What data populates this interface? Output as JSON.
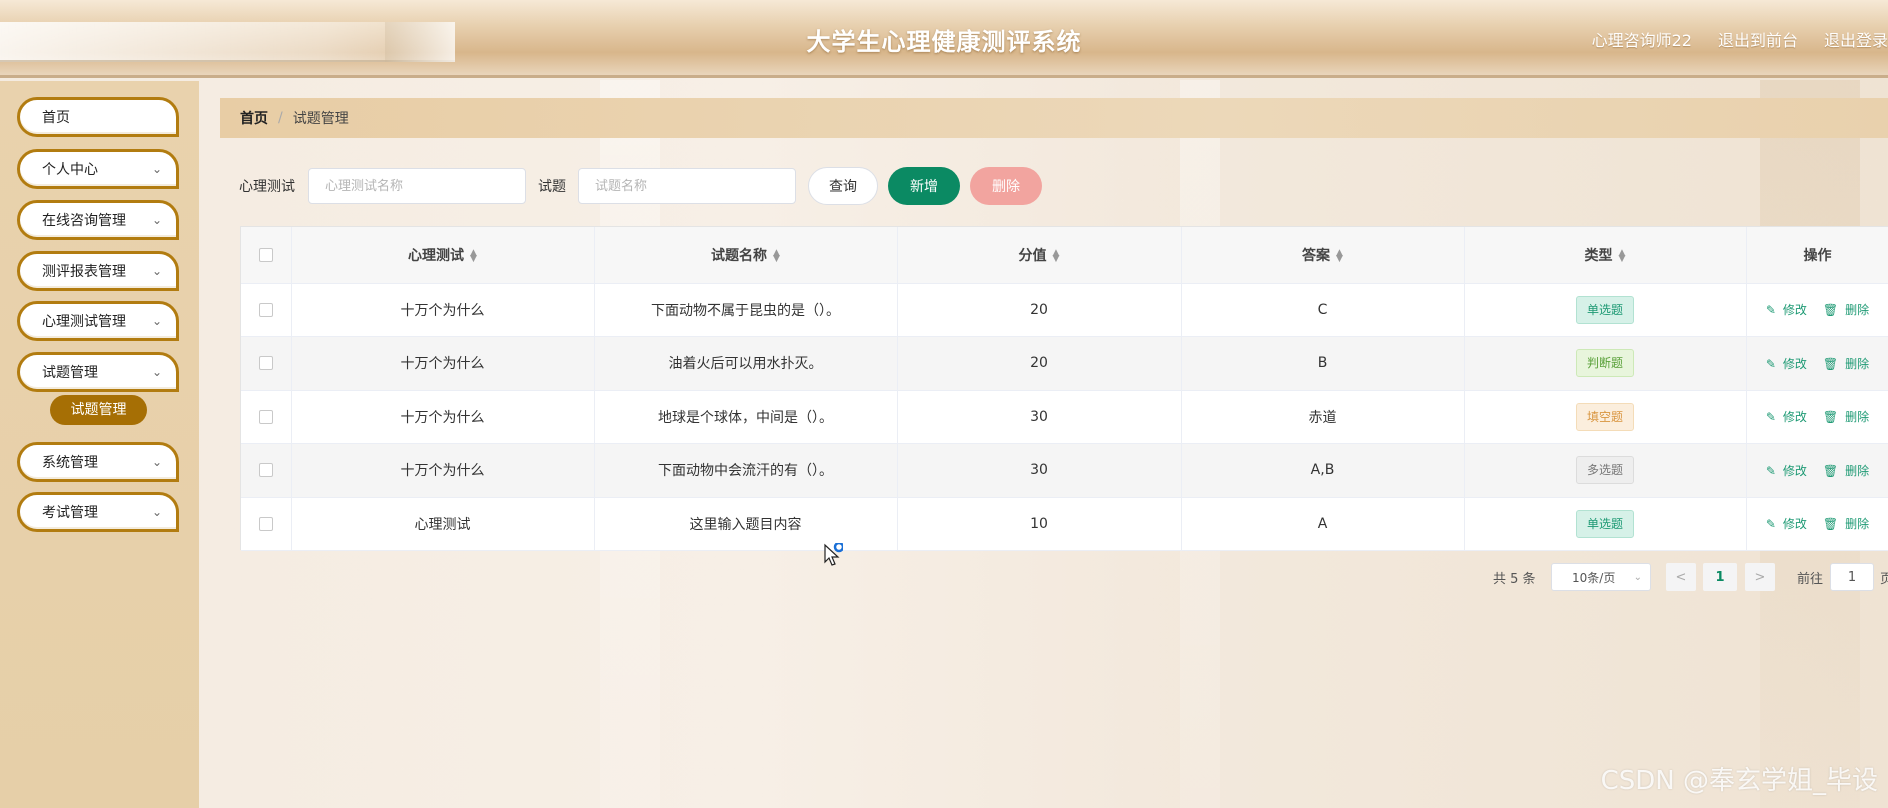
{
  "header": {
    "title": "大学生心理健康测评系统",
    "user": "心理咨询师22",
    "back_front": "退出到前台",
    "logout": "退出登录"
  },
  "sidebar": {
    "items": [
      {
        "label": "首页",
        "has_chevron": false
      },
      {
        "label": "个人中心",
        "has_chevron": true
      },
      {
        "label": "在线咨询管理",
        "has_chevron": true
      },
      {
        "label": "测评报表管理",
        "has_chevron": true
      },
      {
        "label": "心理测试管理",
        "has_chevron": true
      },
      {
        "label": "试题管理",
        "has_chevron": true
      },
      {
        "label": "系统管理",
        "has_chevron": true
      },
      {
        "label": "考试管理",
        "has_chevron": true
      }
    ],
    "sub_active": "试题管理"
  },
  "breadcrumb": {
    "home": "首页",
    "separator": "/",
    "current": "试题管理"
  },
  "search": {
    "test_label": "心理测试",
    "test_placeholder": "心理测试名称",
    "question_label": "试题",
    "question_placeholder": "试题名称",
    "query_button": "查询",
    "add_button": "新增",
    "delete_button": "删除"
  },
  "table": {
    "columns": [
      "心理测试",
      "试题名称",
      "分值",
      "答案",
      "类型",
      "操作"
    ],
    "rows": [
      {
        "test": "十万个为什么",
        "question": "下面动物不属于昆虫的是（）。",
        "score": "20",
        "answer": "C",
        "type": "单选题",
        "type_style": "single"
      },
      {
        "test": "十万个为什么",
        "question": "油着火后可以用水扑灭。",
        "score": "20",
        "answer": "B",
        "type": "判断题",
        "type_style": "judge"
      },
      {
        "test": "十万个为什么",
        "question": "地球是个球体，中间是（）。",
        "score": "30",
        "answer": "赤道",
        "type": "填空题",
        "type_style": "fill"
      },
      {
        "test": "十万个为什么",
        "question": "下面动物中会流汗的有（）。",
        "score": "30",
        "answer": "A,B",
        "type": "多选题",
        "type_style": "multi"
      },
      {
        "test": "心理测试",
        "question": "这里输入题目内容",
        "score": "10",
        "answer": "A",
        "type": "单选题",
        "type_style": "single"
      }
    ],
    "edit_label": "修改",
    "delete_label": "删除"
  },
  "pagination": {
    "total": "共 5 条",
    "page_size": "10条/页",
    "current_page": "1",
    "goto_label": "前往",
    "goto_value": "1",
    "goto_unit": "页"
  },
  "watermark": "CSDN @奉玄学姐_毕设",
  "colors": {
    "accent_green": "#0b8a63",
    "nav_border": "#b27c10",
    "nav_active": "#a66f05",
    "delete_pink": "#f2a49f"
  }
}
